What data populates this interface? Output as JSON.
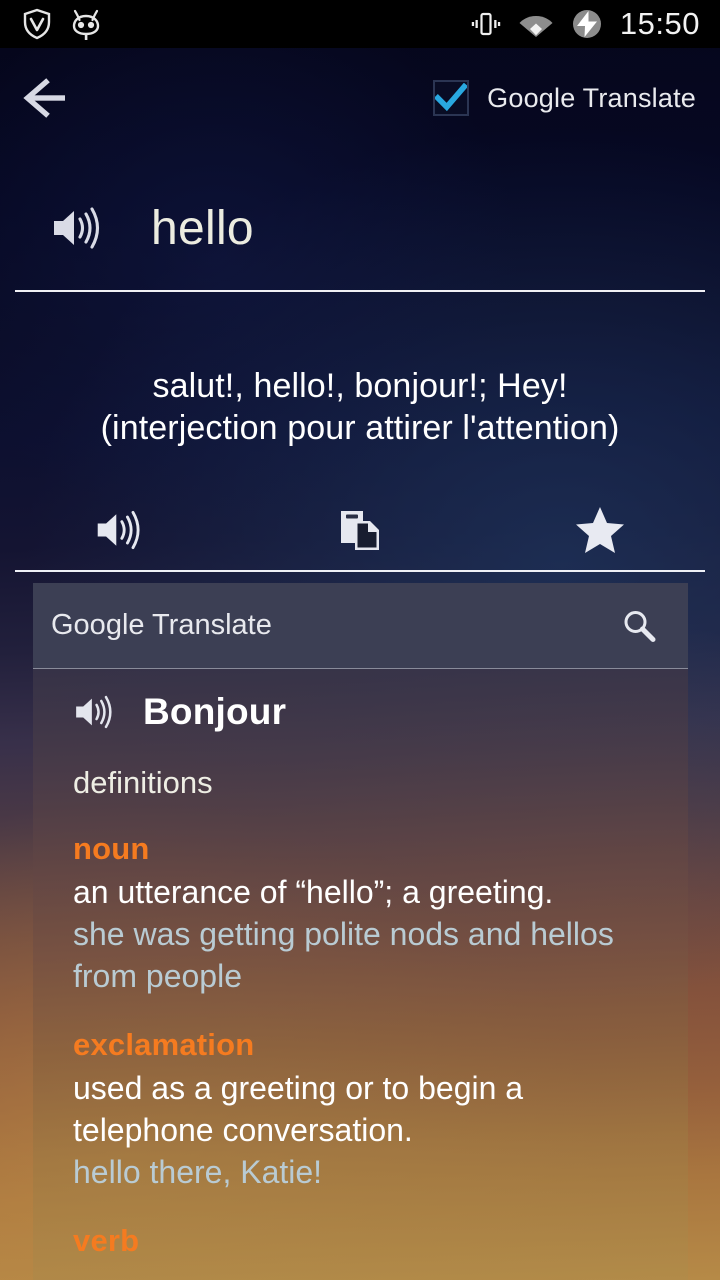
{
  "status_bar": {
    "icons": [
      "privacy-guard-shield-icon",
      "cyanogenmod-cid-icon",
      "vibrate-icon",
      "wifi-icon",
      "charging-bolt-icon"
    ],
    "clock": "15:50"
  },
  "action_bar": {
    "back_label": "back-arrow-icon",
    "app_name": "Google Translate",
    "checkbox_checked": true,
    "accent_color": "#29a8e0"
  },
  "query": {
    "word": "hello",
    "speaker_label": "speaker-icon"
  },
  "translation": {
    "line1": "salut!, hello!, bonjour!; Hey!",
    "line2": "(interjection pour attirer l'attention)"
  },
  "actions": [
    {
      "name": "listen",
      "icon": "speaker-icon"
    },
    {
      "name": "copy",
      "icon": "copy-icon"
    },
    {
      "name": "favorite",
      "icon": "star-icon"
    }
  ],
  "definition_card": {
    "search_label": "Google Translate",
    "search_icon": "search-icon",
    "headword": "Bonjour",
    "headword_speaker": "speaker-icon",
    "section_label": "definitions",
    "accent_color": "#f57b20",
    "example_color": "#b9cbd3",
    "senses": [
      {
        "pos": "noun",
        "definition": "an utterance of “hello”; a greeting.",
        "example": "she was getting polite nods and hellos from people"
      },
      {
        "pos": "exclamation",
        "definition": "used as a greeting or to begin a telephone conversation.",
        "example": "hello there, Katie!"
      },
      {
        "pos": "verb",
        "definition": "",
        "example": ""
      }
    ]
  }
}
